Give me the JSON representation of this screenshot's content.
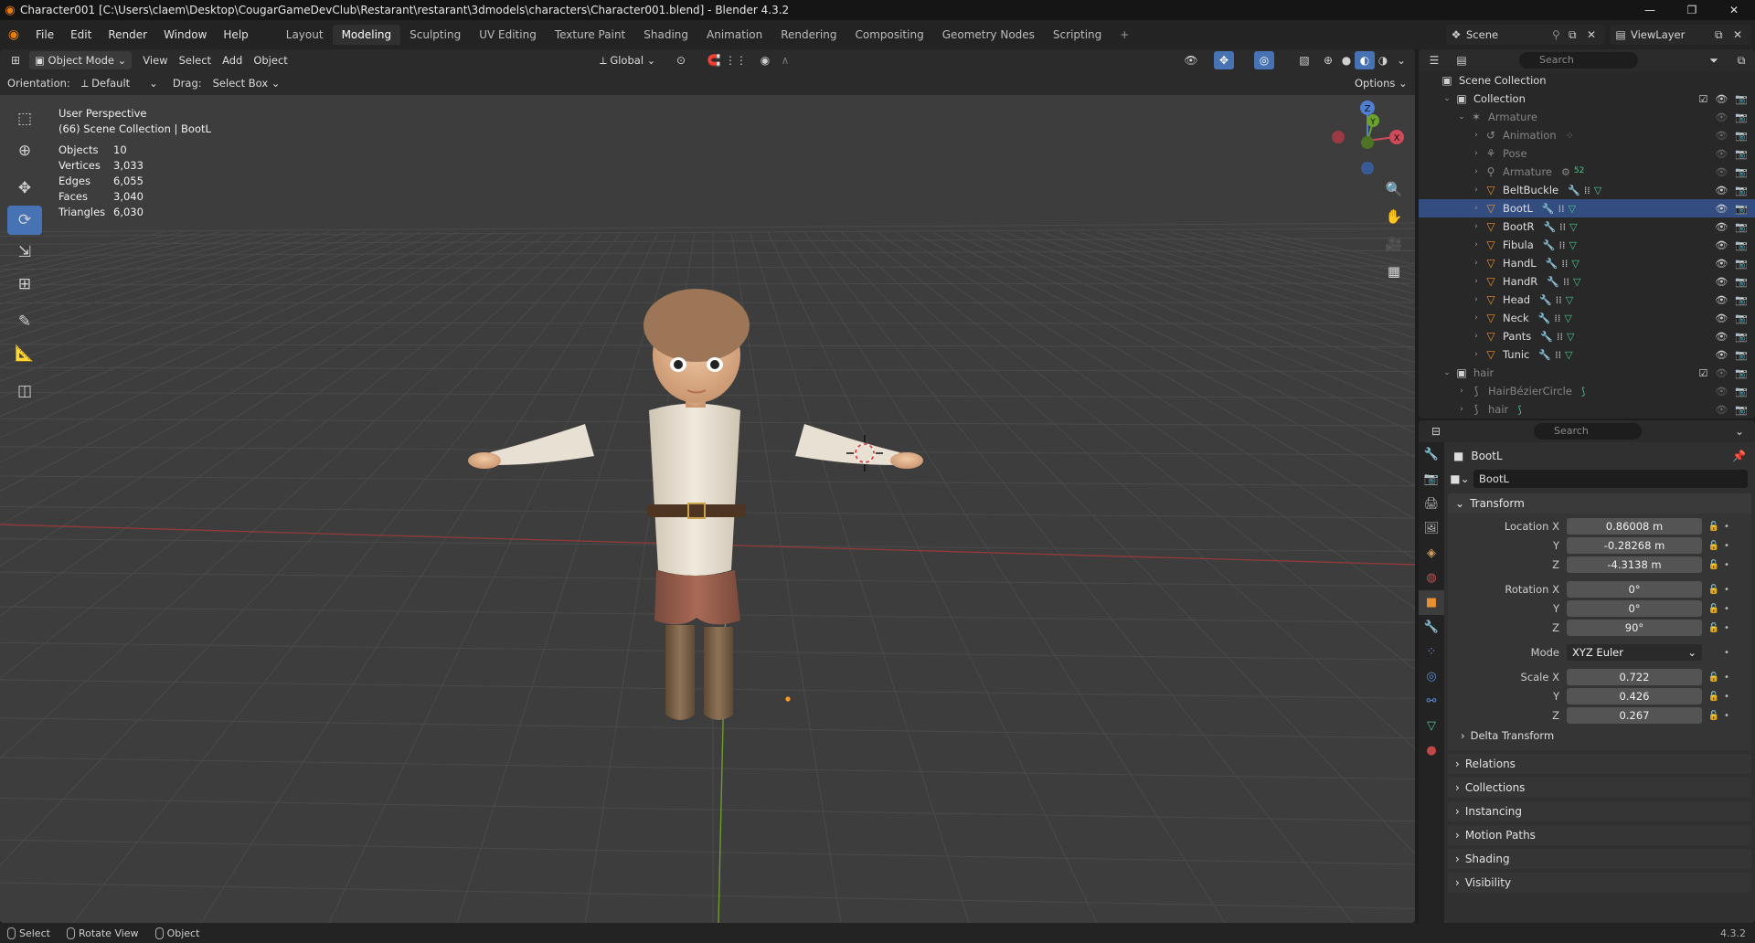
{
  "window": {
    "title": "Character001 [C:\\Users\\claem\\Desktop\\CougarGameDevClub\\Restarant\\restarant\\3dmodels\\characters\\Character001.blend] - Blender 4.3.2",
    "minimize": "—",
    "maximize": "❐",
    "close": "✕"
  },
  "menu": [
    "File",
    "Edit",
    "Render",
    "Window",
    "Help"
  ],
  "workspaces": {
    "tabs": [
      "Layout",
      "Modeling",
      "Sculpting",
      "UV Editing",
      "Texture Paint",
      "Shading",
      "Animation",
      "Rendering",
      "Compositing",
      "Geometry Nodes",
      "Scripting"
    ],
    "active": "Modeling",
    "add": "+"
  },
  "scene": {
    "label": "Scene",
    "view_layer": "ViewLayer"
  },
  "viewport": {
    "mode": "Object Mode",
    "menus": [
      "View",
      "Select",
      "Add",
      "Object"
    ],
    "orientation_label": "Global",
    "tool_header": {
      "orientation_caption": "Orientation:",
      "orientation_value": "Default",
      "drag_caption": "Drag:",
      "drag_value": "Select Box",
      "options": "Options"
    },
    "overlay_text": {
      "perspective": "User Perspective",
      "collection": "(66) Scene Collection | BootL"
    },
    "stats": [
      {
        "label": "Objects",
        "value": "10"
      },
      {
        "label": "Vertices",
        "value": "3,033"
      },
      {
        "label": "Edges",
        "value": "6,055"
      },
      {
        "label": "Faces",
        "value": "3,040"
      },
      {
        "label": "Triangles",
        "value": "6,030"
      }
    ],
    "gizmo": {
      "x": "X",
      "y": "Y",
      "z": "Z"
    },
    "colors": {
      "grid_bg": "#3d3d3d",
      "x_axis": "#9c3a3a",
      "y_axis": "#6c9a2e",
      "selection": "#4772b3"
    }
  },
  "outliner": {
    "search_placeholder": "Search",
    "rows": [
      {
        "label": "Scene Collection",
        "type": "scene"
      },
      {
        "label": "Collection",
        "type": "collection"
      },
      {
        "label": "Armature",
        "type": "armature",
        "dim": true
      },
      {
        "label": "Animation",
        "type": "anim",
        "dim": true
      },
      {
        "label": "Pose",
        "type": "pose",
        "dim": true
      },
      {
        "label": "Armature",
        "type": "armdata",
        "dim": true,
        "badge": "52"
      },
      {
        "label": "BeltBuckle",
        "type": "mesh"
      },
      {
        "label": "BootL",
        "type": "mesh",
        "selected": true
      },
      {
        "label": "BootR",
        "type": "mesh"
      },
      {
        "label": "Fibula",
        "type": "mesh"
      },
      {
        "label": "HandL",
        "type": "mesh"
      },
      {
        "label": "HandR",
        "type": "mesh"
      },
      {
        "label": "Head",
        "type": "mesh"
      },
      {
        "label": "Neck",
        "type": "mesh"
      },
      {
        "label": "Pants",
        "type": "mesh"
      },
      {
        "label": "Tunic",
        "type": "mesh"
      },
      {
        "label": "hair",
        "type": "collection",
        "dim": true
      },
      {
        "label": "HairBézierCircle",
        "type": "curve",
        "dim": true
      },
      {
        "label": "hair",
        "type": "curve",
        "dim": true
      }
    ]
  },
  "properties": {
    "search_placeholder": "Search",
    "object_name": "BootL",
    "data_name": "BootL",
    "transform": {
      "title": "Transform",
      "location": {
        "label": "Location X",
        "x": "0.86008 m",
        "y": "-0.28268 m",
        "z": "-4.3138 m"
      },
      "rotation": {
        "label": "Rotation X",
        "x": "0°",
        "y": "0°",
        "z": "90°"
      },
      "mode": {
        "label": "Mode",
        "value": "XYZ Euler"
      },
      "scale": {
        "label": "Scale X",
        "x": "0.722",
        "y": "0.426",
        "z": "0.267"
      },
      "y_label": "Y",
      "z_label": "Z",
      "delta": "Delta Transform"
    },
    "panels": [
      "Relations",
      "Collections",
      "Instancing",
      "Motion Paths",
      "Shading",
      "Visibility"
    ]
  },
  "statusbar": {
    "items": [
      "Select",
      "Rotate View",
      "Object"
    ],
    "version": "4.3.2"
  }
}
